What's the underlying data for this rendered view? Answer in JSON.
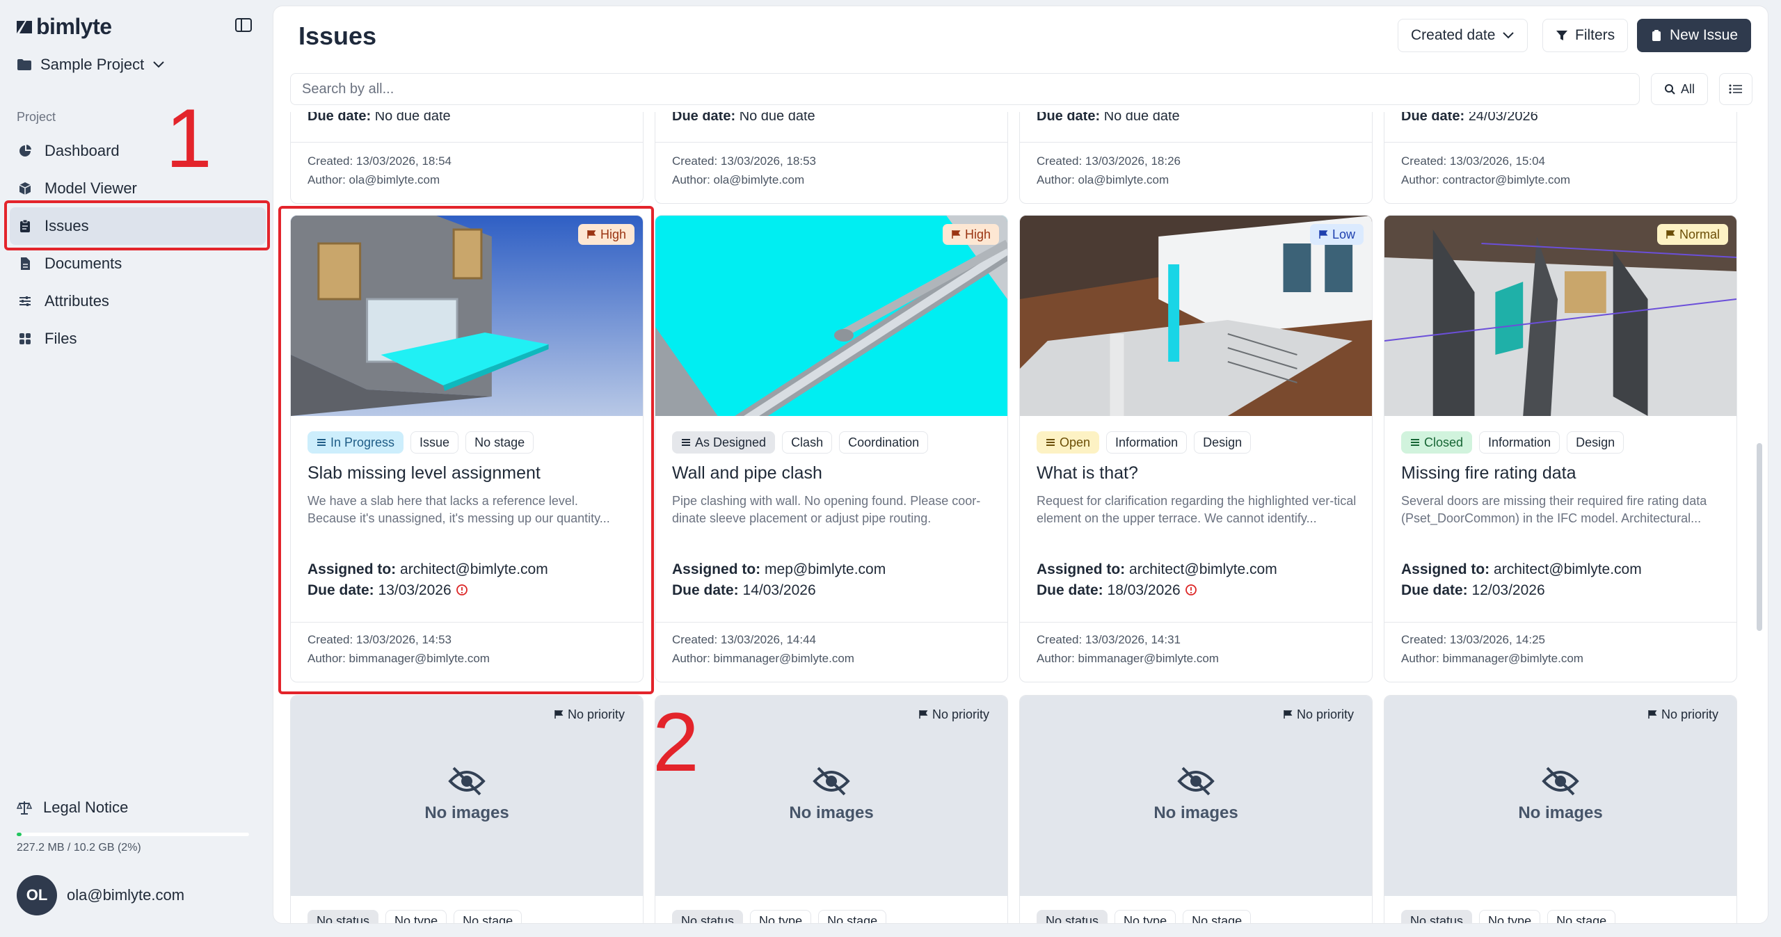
{
  "app": {
    "name": "bimlyte"
  },
  "project": {
    "name": "Sample Project"
  },
  "sidebar": {
    "section_label": "Project",
    "items": [
      {
        "label": "Dashboard",
        "icon": "pie-chart-icon"
      },
      {
        "label": "Model Viewer",
        "icon": "cube-icon"
      },
      {
        "label": "Issues",
        "icon": "clipboard-icon",
        "active": true
      },
      {
        "label": "Documents",
        "icon": "document-icon"
      },
      {
        "label": "Attributes",
        "icon": "sliders-icon"
      },
      {
        "label": "Files",
        "icon": "grid-icon"
      }
    ],
    "legal": "Legal Notice",
    "storage": {
      "text": "227.2 MB / 10.2 GB (2%)",
      "fraction": 0.02
    },
    "user": {
      "initials": "OL",
      "email": "ola@bimlyte.com"
    }
  },
  "annotations": {
    "one": "1",
    "two": "2",
    "color": "#e3242b"
  },
  "header": {
    "title": "Issues",
    "sort_label": "Created date",
    "filters_label": "Filters",
    "new_issue_label": "New Issue"
  },
  "search": {
    "placeholder": "Search by all...",
    "scope_label": "All"
  },
  "top_row": [
    {
      "due_label": "Due date:",
      "due": "No due date",
      "created": "Created: 13/03/2026, 18:54",
      "author": "Author: ola@bimlyte.com"
    },
    {
      "due_label": "Due date:",
      "due": "No due date",
      "created": "Created: 13/03/2026, 18:53",
      "author": "Author: ola@bimlyte.com"
    },
    {
      "due_label": "Due date:",
      "due": "No due date",
      "created": "Created: 13/03/2026, 18:26",
      "author": "Author: ola@bimlyte.com"
    },
    {
      "due_label": "Due date:",
      "due": "24/03/2026",
      "created": "Created: 13/03/2026, 15:04",
      "author": "Author: contractor@bimlyte.com"
    }
  ],
  "cards": [
    {
      "priority": "High",
      "status": "In Progress",
      "type": "Issue",
      "stage": "No stage",
      "title": "Slab missing level assignment",
      "description": "We have a slab here that lacks a reference level. Because it's unassigned, it's messing up our quantity...",
      "assigned_label": "Assigned to:",
      "assigned": "architect@bimlyte.com",
      "due_label": "Due date:",
      "due": "13/03/2026",
      "created": "Created: 13/03/2026, 14:53",
      "author": "Author: bimmanager@bimlyte.com"
    },
    {
      "priority": "High",
      "status": "As Designed",
      "type": "Clash",
      "stage": "Coordination",
      "title": "Wall and pipe clash",
      "description": "Pipe clashing with wall. No opening found. Please coor-dinate sleeve placement or adjust pipe routing.",
      "assigned_label": "Assigned to:",
      "assigned": "mep@bimlyte.com",
      "due_label": "Due date:",
      "due": "14/03/2026",
      "created": "Created: 13/03/2026, 14:44",
      "author": "Author: bimmanager@bimlyte.com"
    },
    {
      "priority": "Low",
      "status": "Open",
      "type": "Information",
      "stage": "Design",
      "title": "What is that?",
      "description": "Request for clarification regarding the highlighted ver-tical element on the upper terrace. We cannot identify...",
      "assigned_label": "Assigned to:",
      "assigned": "architect@bimlyte.com",
      "due_label": "Due date:",
      "due": "18/03/2026",
      "created": "Created: 13/03/2026, 14:31",
      "author": "Author: bimmanager@bimlyte.com"
    },
    {
      "priority": "Normal",
      "status": "Closed",
      "type": "Information",
      "stage": "Design",
      "title": "Missing fire rating data",
      "description": "Several doors are missing their required fire rating data (Pset_DoorCommon) in the IFC model. Architectural...",
      "assigned_label": "Assigned to:",
      "assigned": "architect@bimlyte.com",
      "due_label": "Due date:",
      "due": "12/03/2026",
      "created": "Created: 13/03/2026, 14:25",
      "author": "Author: bimmanager@bimlyte.com"
    }
  ],
  "bottom_row": [
    {
      "priority": "No priority",
      "no_images": "No images",
      "status": "No status",
      "type": "No type",
      "stage": "No stage"
    },
    {
      "priority": "No priority",
      "no_images": "No images",
      "status": "No status",
      "type": "No type",
      "stage": "No stage"
    },
    {
      "priority": "No priority",
      "no_images": "No images",
      "status": "No status",
      "type": "No type",
      "stage": "No stage"
    },
    {
      "priority": "No priority",
      "no_images": "No images",
      "status": "No status",
      "type": "No type",
      "stage": "No stage"
    }
  ]
}
